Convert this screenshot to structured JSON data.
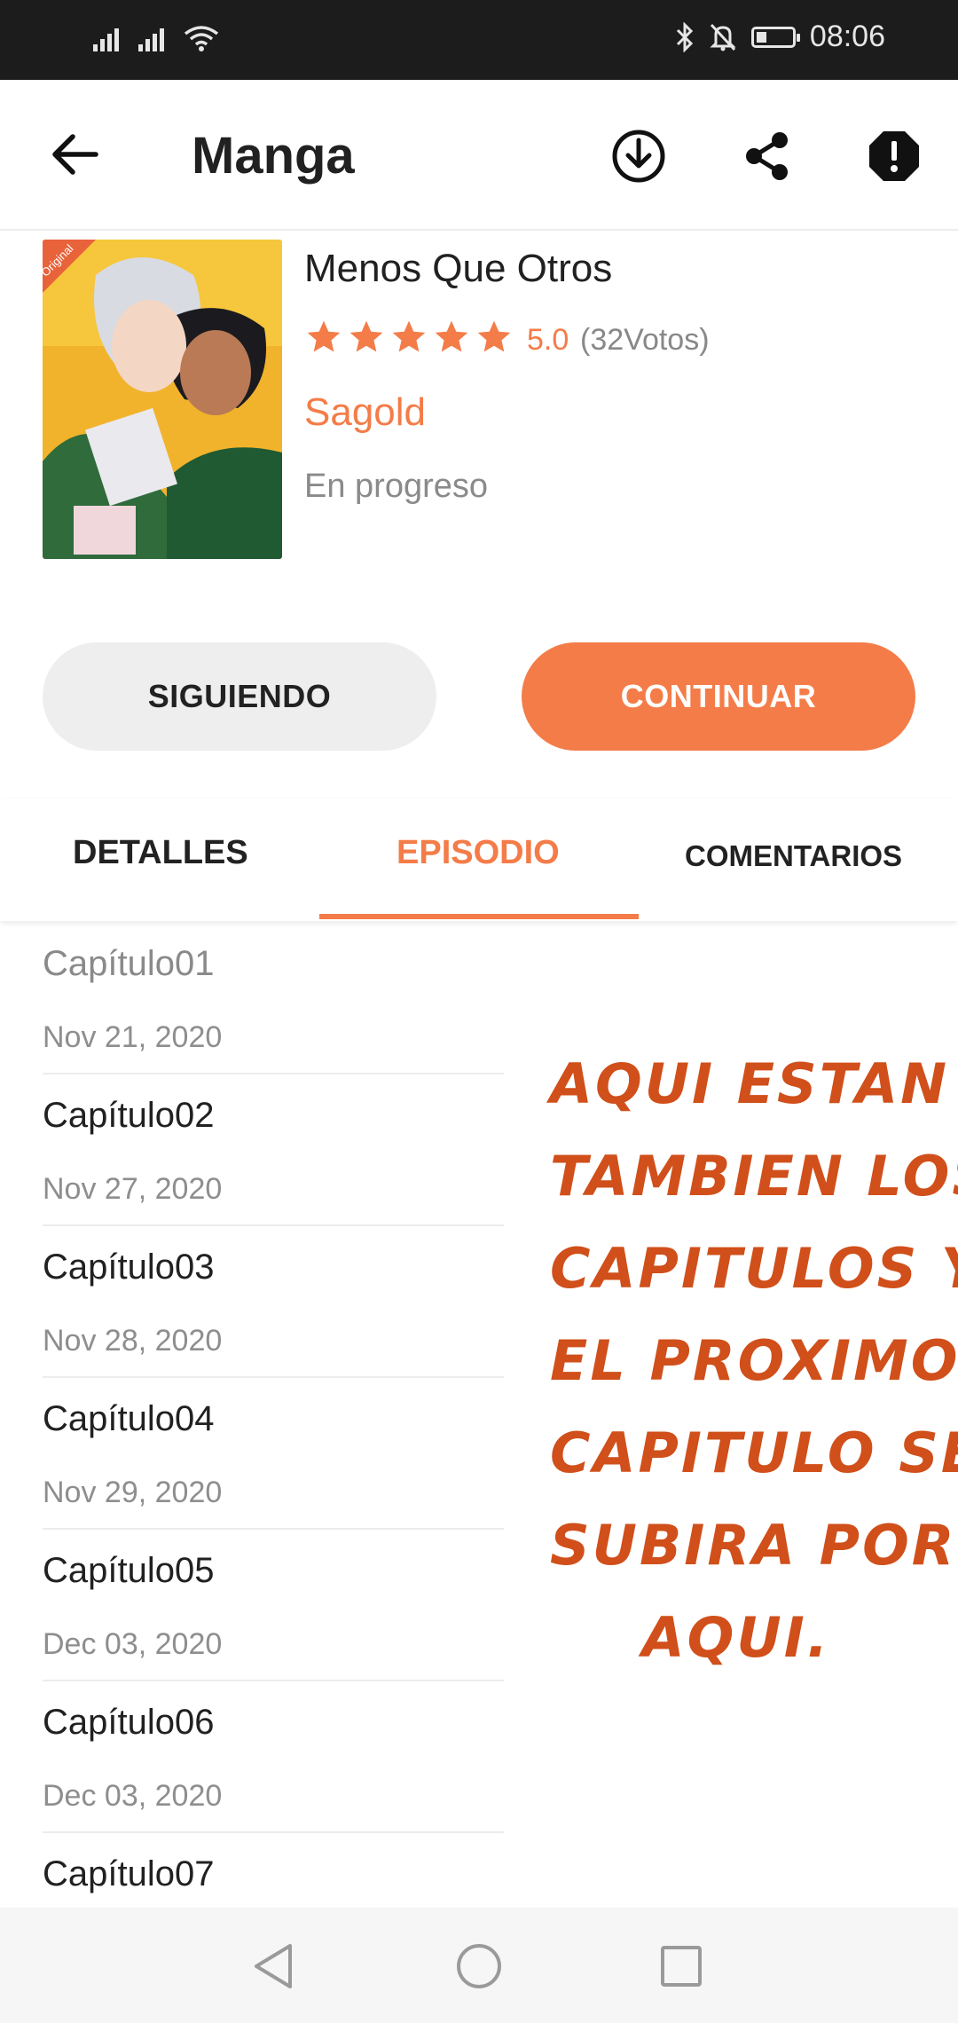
{
  "status_bar": {
    "time": "08:06",
    "battery_level": 0.3,
    "icons": [
      "signal-icon",
      "signal-icon",
      "wifi-icon",
      "bluetooth-icon",
      "mute-bell-icon",
      "battery-icon"
    ]
  },
  "app_bar": {
    "title": "Manga",
    "actions": [
      "download-icon",
      "share-icon",
      "report-icon"
    ]
  },
  "manga": {
    "title": "Menos Que Otros",
    "rating_value": "5.0",
    "votes": "(32Votos)",
    "stars": 5,
    "author": "Sagold",
    "status": "En progreso",
    "cover_badge": "Original"
  },
  "buttons": {
    "follow": "SIGUIENDO",
    "continue": "CONTINUAR"
  },
  "tabs": [
    {
      "label": "DETALLES"
    },
    {
      "label": "EPISODIO"
    },
    {
      "label": "COMENTARIOS"
    }
  ],
  "episodes": [
    {
      "title": "Capítulo01",
      "date": "Nov 21, 2020"
    },
    {
      "title": "Capítulo02",
      "date": "Nov 27, 2020"
    },
    {
      "title": "Capítulo03",
      "date": "Nov 28, 2020"
    },
    {
      "title": "Capítulo04",
      "date": "Nov 29, 2020"
    },
    {
      "title": "Capítulo05",
      "date": "Dec 03, 2020"
    },
    {
      "title": "Capítulo06",
      "date": "Dec 03, 2020"
    },
    {
      "title": "Capítulo07",
      "date": ""
    }
  ],
  "annotation": {
    "lines": [
      "AQUI ESTAN",
      "TAMBIEN LOS",
      "CAPITULOS Y",
      "EL PROXIMO",
      "CAPITULO SE",
      "SUBIRA POR",
      "AQUI."
    ]
  },
  "colors": {
    "accent": "#f47c48",
    "annotation": "#d04f1a",
    "status_bar": "#1c1c1c"
  }
}
